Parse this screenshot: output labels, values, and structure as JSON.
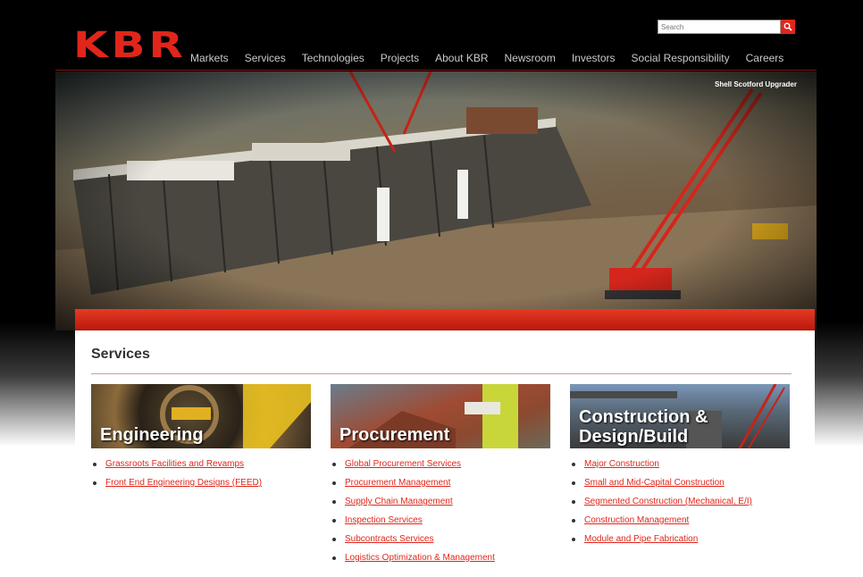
{
  "brand": {
    "logo_text": "KBR",
    "accent_color": "#e0261b"
  },
  "search": {
    "placeholder": "Search",
    "button_icon": "search-icon"
  },
  "nav": {
    "items": [
      {
        "label": "Markets"
      },
      {
        "label": "Services"
      },
      {
        "label": "Technologies"
      },
      {
        "label": "Projects"
      },
      {
        "label": "About KBR"
      },
      {
        "label": "Newsroom"
      },
      {
        "label": "Investors"
      },
      {
        "label": "Social Responsibility"
      },
      {
        "label": "Careers"
      }
    ]
  },
  "hero": {
    "caption": "Shell Scotford Upgrader"
  },
  "services": {
    "title": "Services",
    "columns": [
      {
        "banner": "Engineering",
        "links": [
          "Grassroots Facilities and Revamps",
          "Front End Engineering Designs (FEED)"
        ]
      },
      {
        "banner": "Procurement",
        "links": [
          "Global Procurement Services",
          "Procurement Management",
          "Supply Chain Management",
          "Inspection Services",
          "Subcontracts Services",
          "Logistics Optimization & Management"
        ]
      },
      {
        "banner_line1": "Construction &",
        "banner_line2": "Design/Build",
        "links": [
          "Major Construction",
          "Small and Mid-Capital Construction",
          "Segmented Construction (Mechanical, E/I)",
          "Construction Management",
          "Module and Pipe Fabrication"
        ]
      }
    ]
  }
}
